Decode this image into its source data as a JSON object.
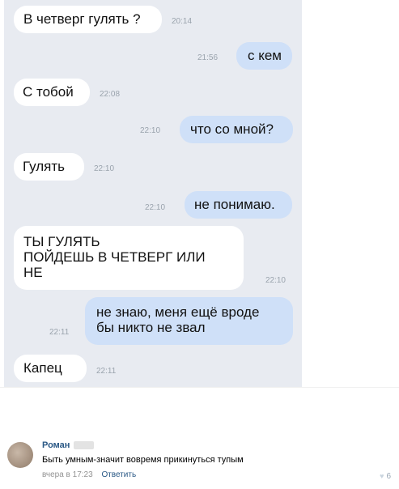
{
  "colors": {
    "chat_background": "#e8ebf1",
    "incoming_bubble": "#ffffff",
    "outgoing_bubble": "#cfe0f8",
    "link": "#2a5885"
  },
  "messages": [
    {
      "text": "В четверг гулять ?",
      "time": "20:14",
      "direction": "in"
    },
    {
      "text": "с кем",
      "time": "21:56",
      "direction": "out"
    },
    {
      "text": "С тобой",
      "time": "22:08",
      "direction": "in"
    },
    {
      "text": "что со мной?",
      "time": "22:10",
      "direction": "out"
    },
    {
      "text": "Гулять",
      "time": "22:10",
      "direction": "in"
    },
    {
      "text": "не понимаю.",
      "time": "22:10",
      "direction": "out"
    },
    {
      "lines": [
        "ТЫ ГУЛЯТЬ",
        "ПОЙДЕШЬ В ЧЕТВЕРГ ИЛИ",
        "НЕ"
      ],
      "time": "22:10",
      "direction": "in"
    },
    {
      "lines": [
        "не знаю, меня ещё вроде",
        "бы никто не звал"
      ],
      "time": "22:11",
      "direction": "out"
    },
    {
      "text": "Капец",
      "time": "22:11",
      "direction": "in"
    }
  ],
  "comment": {
    "author": "Роман",
    "text": "Быть умным-значит вовремя прикинуться тупым",
    "timestamp": "вчера в 17:23",
    "reply_label": "Ответить",
    "like_icon": "heart-icon",
    "likes": "6"
  }
}
